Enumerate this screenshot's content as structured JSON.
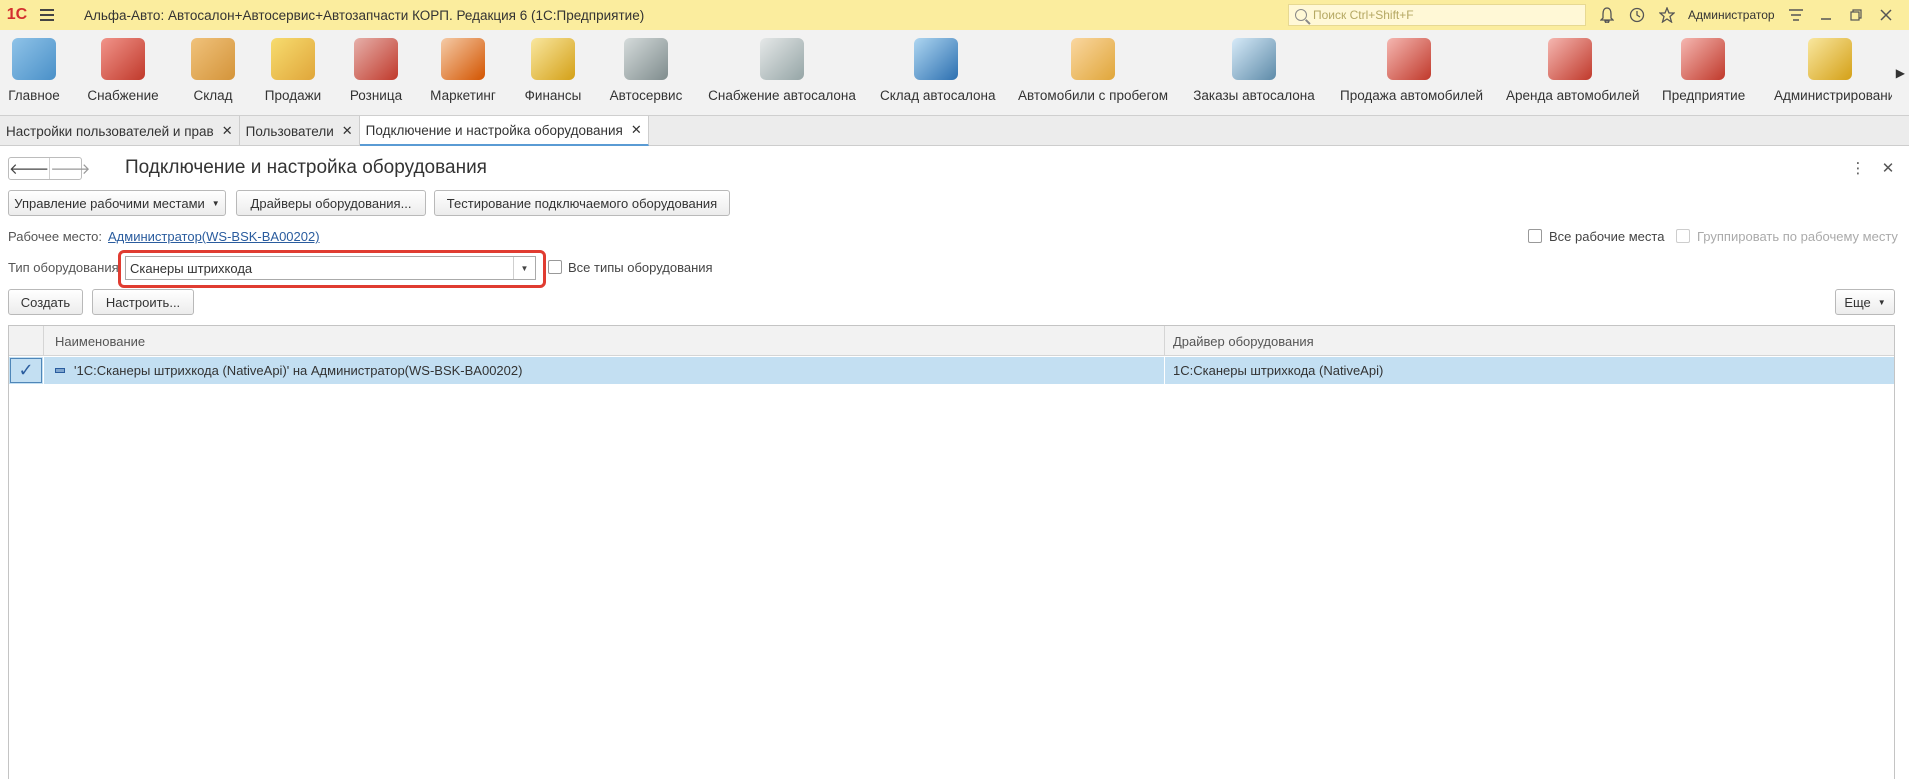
{
  "app": {
    "logo": "1С",
    "title": "Альфа-Авто: Автосалон+Автосервис+Автозапчасти КОРП. Редакция 6  (1С:Предприятие)",
    "search_placeholder": "Поиск Ctrl+Shift+F",
    "user": "Администратор"
  },
  "sections": [
    {
      "label": "Главное",
      "color": "#4a90c8"
    },
    {
      "label": "Снабжение",
      "color": "#c0392b"
    },
    {
      "label": "Склад",
      "color": "#d4943a"
    },
    {
      "label": "Продажи",
      "color": "#e0a63a"
    },
    {
      "label": "Розница",
      "color": "#c0392b"
    },
    {
      "label": "Маркетинг",
      "color": "#d35400"
    },
    {
      "label": "Финансы",
      "color": "#d4a017"
    },
    {
      "label": "Автосервис",
      "color": "#7f8c8d"
    },
    {
      "label": "Снабжение автосалона",
      "color": "#95a5a6"
    },
    {
      "label": "Склад автосалона",
      "color": "#2c6fb0"
    },
    {
      "label": "Автомобили с пробегом",
      "color": "#e0a63a"
    },
    {
      "label": "Заказы автосалона",
      "color": "#5d8aa8"
    },
    {
      "label": "Продажа автомобилей",
      "color": "#c0392b"
    },
    {
      "label": "Аренда автомобилей",
      "color": "#c0392b"
    },
    {
      "label": "Предприятие",
      "color": "#c0392b"
    },
    {
      "label": "Администрирование",
      "color": "#d4a017"
    }
  ],
  "tabs": [
    {
      "label": "Настройки пользователей и прав"
    },
    {
      "label": "Пользователи"
    },
    {
      "label": "Подключение и настройка оборудования"
    }
  ],
  "form": {
    "title": "Подключение и настройка оборудования",
    "buttons": {
      "workplaces": "Управление рабочими местами",
      "drivers": "Драйверы оборудования...",
      "testing": "Тестирование подключаемого оборудования",
      "create": "Создать",
      "configure": "Настроить...",
      "more": "Еще"
    },
    "workplace_label": "Рабочее место:",
    "workplace_value": "Администратор(WS-BSK-BA00202)",
    "all_workplaces": "Все рабочие места",
    "group_by_workplace": "Группировать по рабочему месту",
    "equipment_type_label": "Тип оборудования",
    "equipment_type_value": "Сканеры штрихкода",
    "all_types": "Все типы оборудования"
  },
  "table": {
    "columns": [
      "Наименование",
      "Драйвер оборудования"
    ],
    "rows": [
      {
        "name": "'1С:Сканеры штрихкода (NativeApi)' на Администратор(WS-BSK-BA00202)",
        "driver": "1С:Сканеры штрихкода (NativeApi)",
        "checked": true
      }
    ]
  }
}
